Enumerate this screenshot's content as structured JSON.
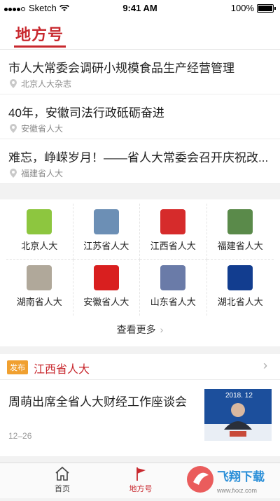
{
  "status": {
    "carrier": "Sketch",
    "time": "9:41 AM",
    "battery": "100%"
  },
  "header": {
    "title": "地方号"
  },
  "news": [
    {
      "headline": "市人大常委会调研小规模食品生产经营管理",
      "source": "北京人大杂志"
    },
    {
      "headline": "40年，安徽司法行政砥砺奋进",
      "source": "安徽省人大"
    },
    {
      "headline": "难忘，峥嵘岁月！——省人大常委会召开庆祝改...",
      "source": "福建省人大"
    }
  ],
  "provinces": [
    {
      "label": "北京人大",
      "color": "#8dc63f"
    },
    {
      "label": "江苏省人大",
      "color": "#6c8fb5"
    },
    {
      "label": "江西省人大",
      "color": "#d62b2b"
    },
    {
      "label": "福建省人大",
      "color": "#5a8a4a"
    },
    {
      "label": "湖南省人大",
      "color": "#b0a89a"
    },
    {
      "label": "安徽省人大",
      "color": "#d91f1f"
    },
    {
      "label": "山东省人大",
      "color": "#6a7ba8"
    },
    {
      "label": "湖北省人大",
      "color": "#123d8f"
    }
  ],
  "see_more": {
    "label": "查看更多"
  },
  "section": {
    "badge": "发布",
    "title": "江西省人大",
    "article": {
      "title": "周萌出席全省人大财经工作座谈会",
      "date": "12–26",
      "image_caption": "2018. 12"
    }
  },
  "tabs": {
    "home": "首页",
    "local": "地方号"
  },
  "watermark": {
    "text": "飞翔下载",
    "url": "www.fxxz.com"
  },
  "colors": {
    "accent": "#c8282e",
    "badge": "#f0a030"
  }
}
